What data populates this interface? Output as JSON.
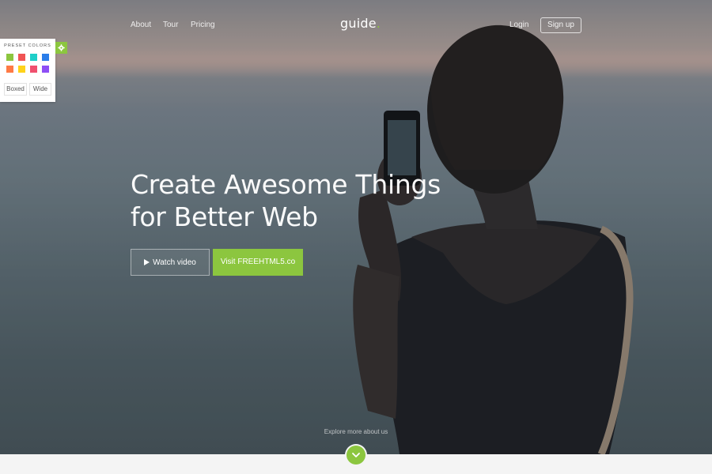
{
  "nav": {
    "left_links": [
      "About",
      "Tour",
      "Pricing"
    ],
    "brand": "guide",
    "brand_dot": ".",
    "login": "Login",
    "signup": "Sign up"
  },
  "preset_panel": {
    "title": "PRESET COLORS",
    "colors": [
      "#8cc63f",
      "#f05454",
      "#1fcfc9",
      "#2b7de9",
      "#ff7a45",
      "#ffd31a",
      "#f0506e",
      "#8e4ef5"
    ],
    "layout_options": [
      "Boxed",
      "Wide"
    ],
    "toggle_icon": "gear-icon"
  },
  "hero": {
    "headline_line1": "Create Awesome Things",
    "headline_line2": "for Better Web",
    "watch_button": "Watch video",
    "watch_icon": "play-icon",
    "visit_button": "Visit FREEHTML5.co",
    "explore_text": "Explore more about us",
    "scroll_icon": "chevron-down-icon"
  },
  "colors": {
    "accent": "#8cc63f"
  }
}
